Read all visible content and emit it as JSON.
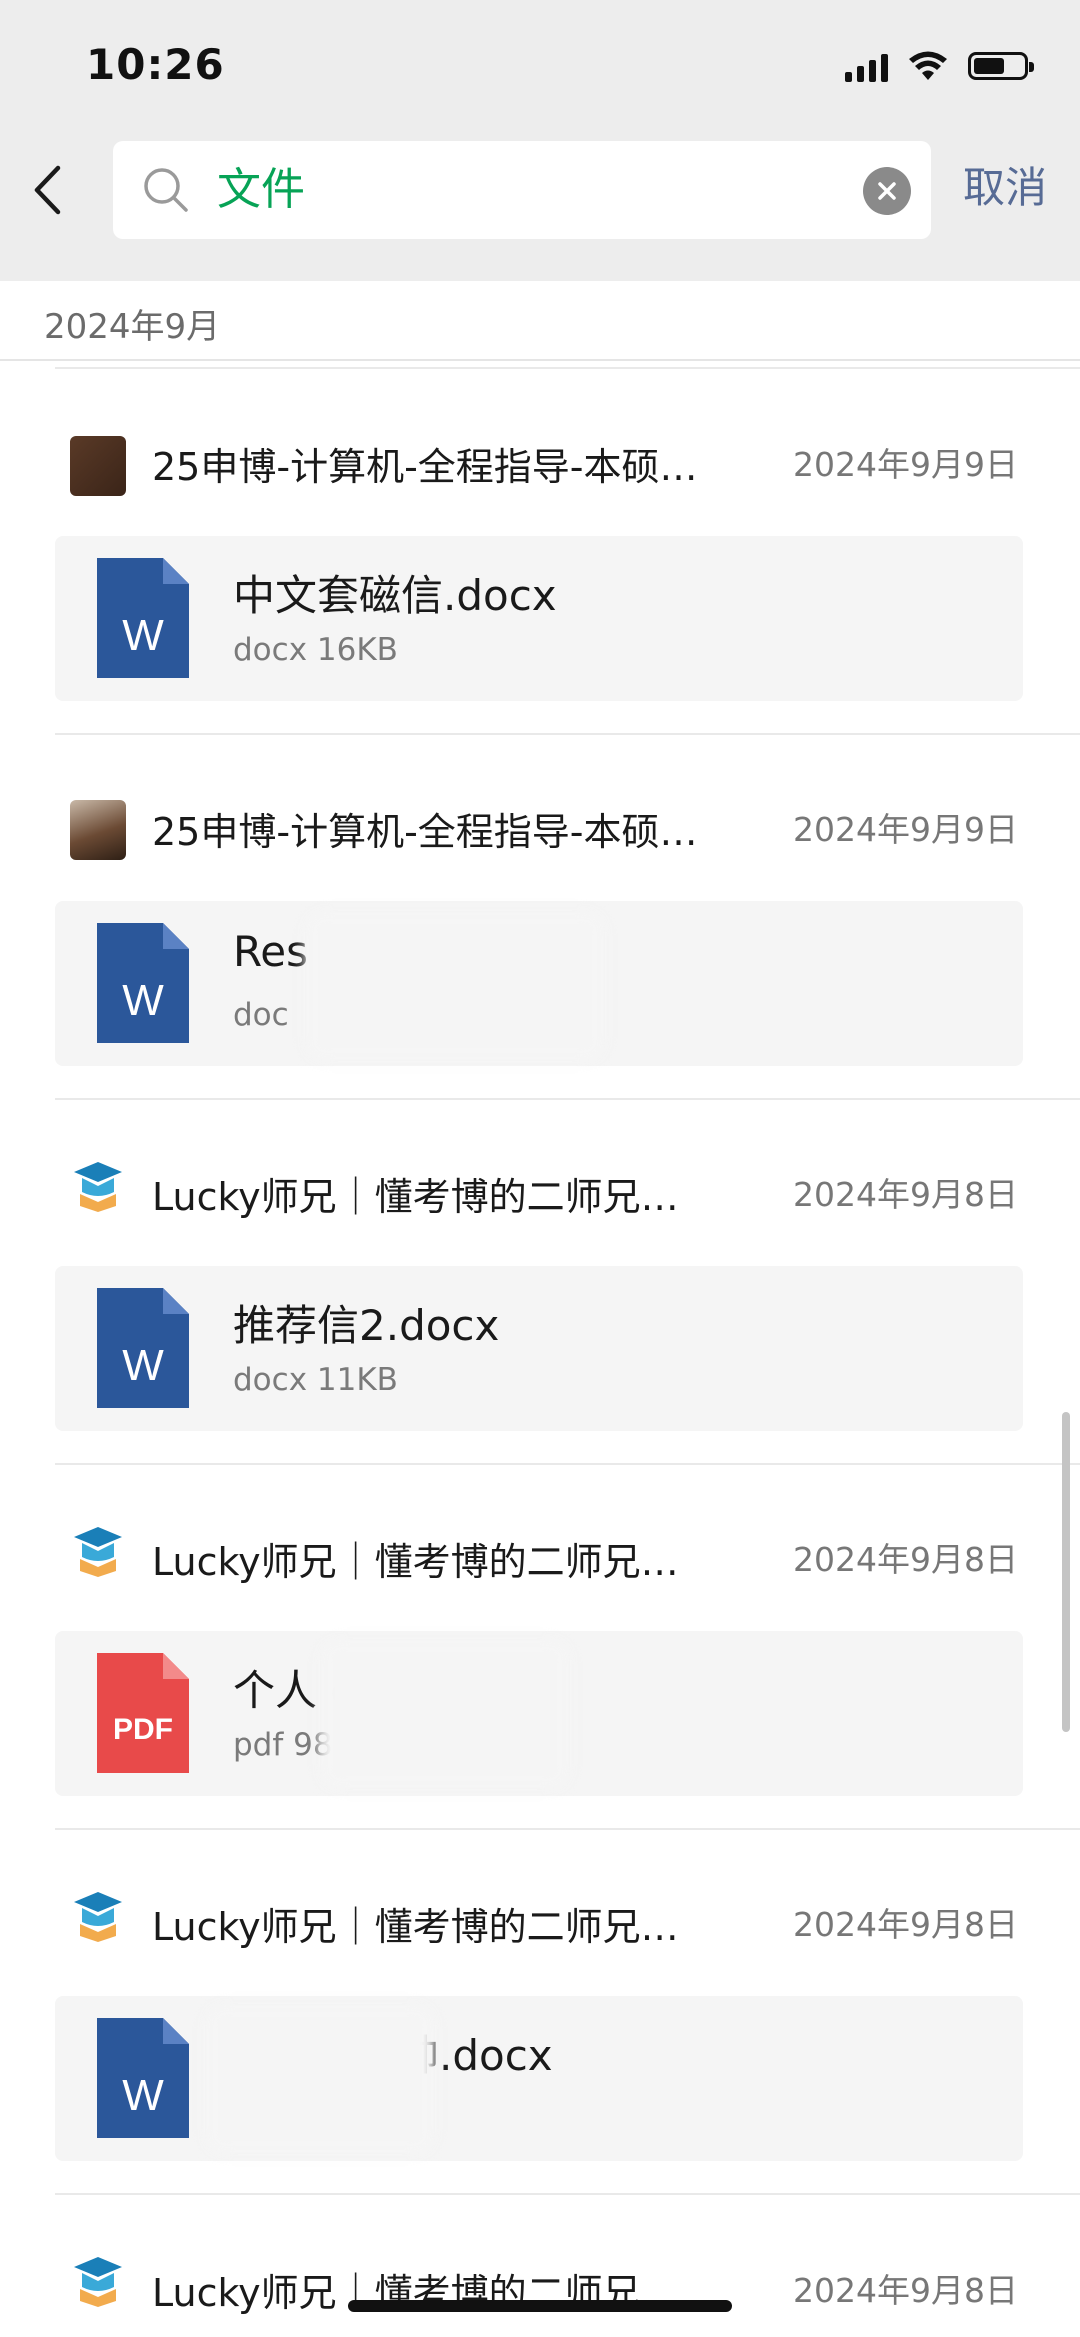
{
  "status_bar": {
    "time": "10:26"
  },
  "search": {
    "query": "文件",
    "cancel_label": "取消"
  },
  "section": {
    "month": "2024年9月"
  },
  "messages": [
    {
      "sender": "25申博-计算机-全程指导-本硕…",
      "date": "2024年9月9日",
      "file": {
        "name": "中文套磁信.docx",
        "meta": "docx 16KB",
        "type": "W"
      }
    },
    {
      "sender": "25申博-计算机-全程指导-本硕…",
      "date": "2024年9月9日",
      "file": {
        "name": "Res                docx",
        "meta": "doc",
        "type": "W"
      }
    },
    {
      "sender": "Lucky师兄｜懂考博的二师兄…",
      "date": "2024年9月8日",
      "file": {
        "name": "推荐信2.docx",
        "meta": "docx 11KB",
        "type": "W"
      }
    },
    {
      "sender": "Lucky师兄｜懂考博的二师兄…",
      "date": "2024年9月8日",
      "file": {
        "name": "个人                df",
        "meta": "pdf 985KB",
        "type": "PDF"
      }
    },
    {
      "sender": "Lucky师兄｜懂考博的二师兄…",
      "date": "2024年9月8日",
      "file": {
        "name": "张帅.docx",
        "meta": "",
        "type": "W"
      }
    },
    {
      "sender": "Lucky师兄｜懂考博的二师兄…",
      "date": "2024年9月8日"
    }
  ],
  "colors": {
    "accent_green": "#07a356",
    "link_blue": "#576b95",
    "word_blue": "#2b579a",
    "pdf_red": "#e84a4a"
  }
}
